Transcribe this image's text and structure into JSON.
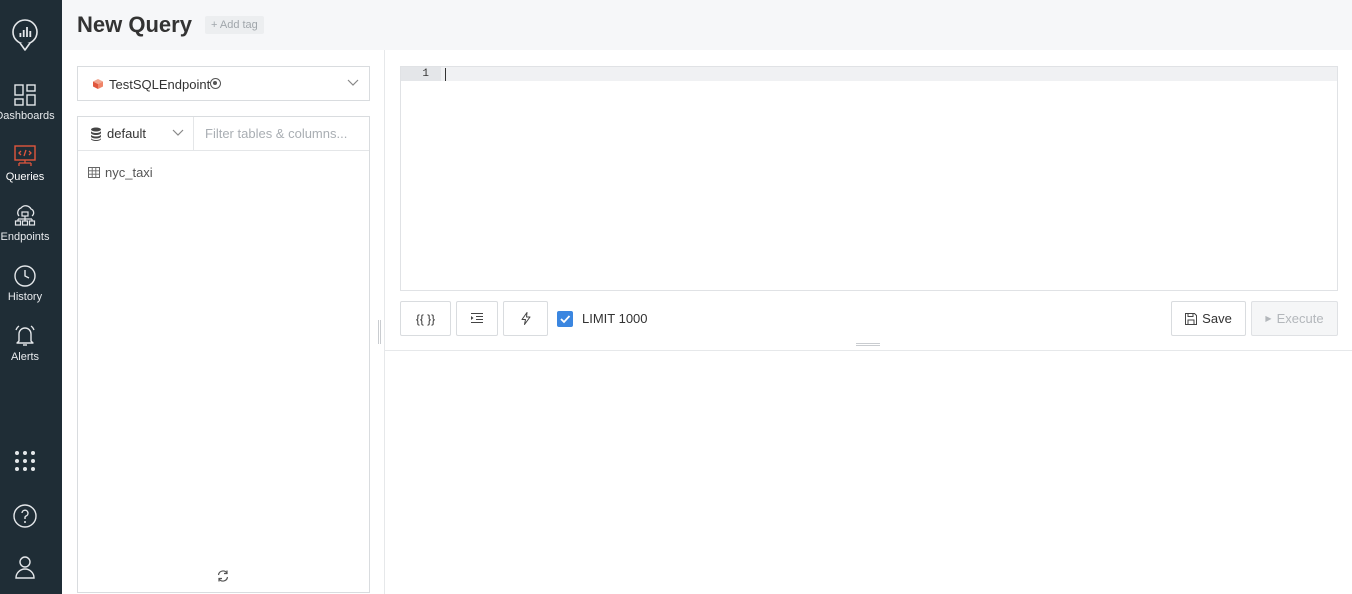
{
  "sidebar": {
    "items": [
      {
        "label": "Dashboards",
        "icon": "dashboards-icon"
      },
      {
        "label": "Queries",
        "icon": "queries-icon",
        "active": true
      },
      {
        "label": "Endpoints",
        "icon": "endpoints-icon"
      },
      {
        "label": "History",
        "icon": "history-icon"
      },
      {
        "label": "Alerts",
        "icon": "alerts-icon"
      }
    ],
    "active_color": "#e0563d",
    "background": "#1f2d36"
  },
  "header": {
    "title": "New Query",
    "add_tag": "+ Add tag"
  },
  "schema": {
    "endpoint": "TestSQLEndpoint",
    "database": "default",
    "filter_placeholder": "Filter tables & columns...",
    "tables": [
      "nyc_taxi"
    ]
  },
  "editor": {
    "line_numbers": [
      "1"
    ],
    "content": ""
  },
  "toolbar": {
    "params_label": "{{ }}",
    "limit_label": "LIMIT 1000",
    "limit_checked": true,
    "save_label": "Save",
    "execute_label": "Execute"
  }
}
